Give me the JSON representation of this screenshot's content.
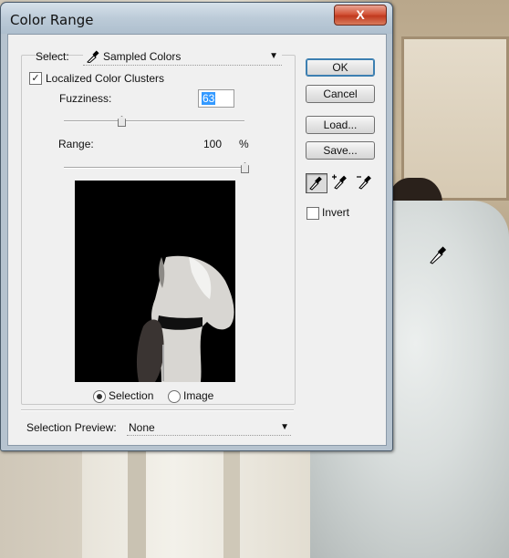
{
  "window": {
    "title": "Color Range",
    "close_glyph": "X"
  },
  "select": {
    "label": "Select:",
    "value": "Sampled Colors",
    "icon": "eyedropper-icon"
  },
  "localized": {
    "label": "Localized Color Clusters",
    "checked": true
  },
  "fuzziness": {
    "label": "Fuzziness:",
    "value": "63",
    "slider_fraction": 0.32
  },
  "range": {
    "label": "Range:",
    "value": "100",
    "unit": "%",
    "slider_fraction": 1.0
  },
  "view": {
    "selection_label": "Selection",
    "image_label": "Image",
    "selected": "Selection"
  },
  "preview_mode": {
    "label": "Selection Preview:",
    "value": "None"
  },
  "buttons": {
    "ok": "OK",
    "cancel": "Cancel",
    "load": "Load...",
    "save": "Save..."
  },
  "tools": [
    "eyedropper-icon",
    "eyedropper-plus-icon",
    "eyedropper-minus-icon"
  ],
  "invert": {
    "label": "Invert",
    "checked": false
  }
}
